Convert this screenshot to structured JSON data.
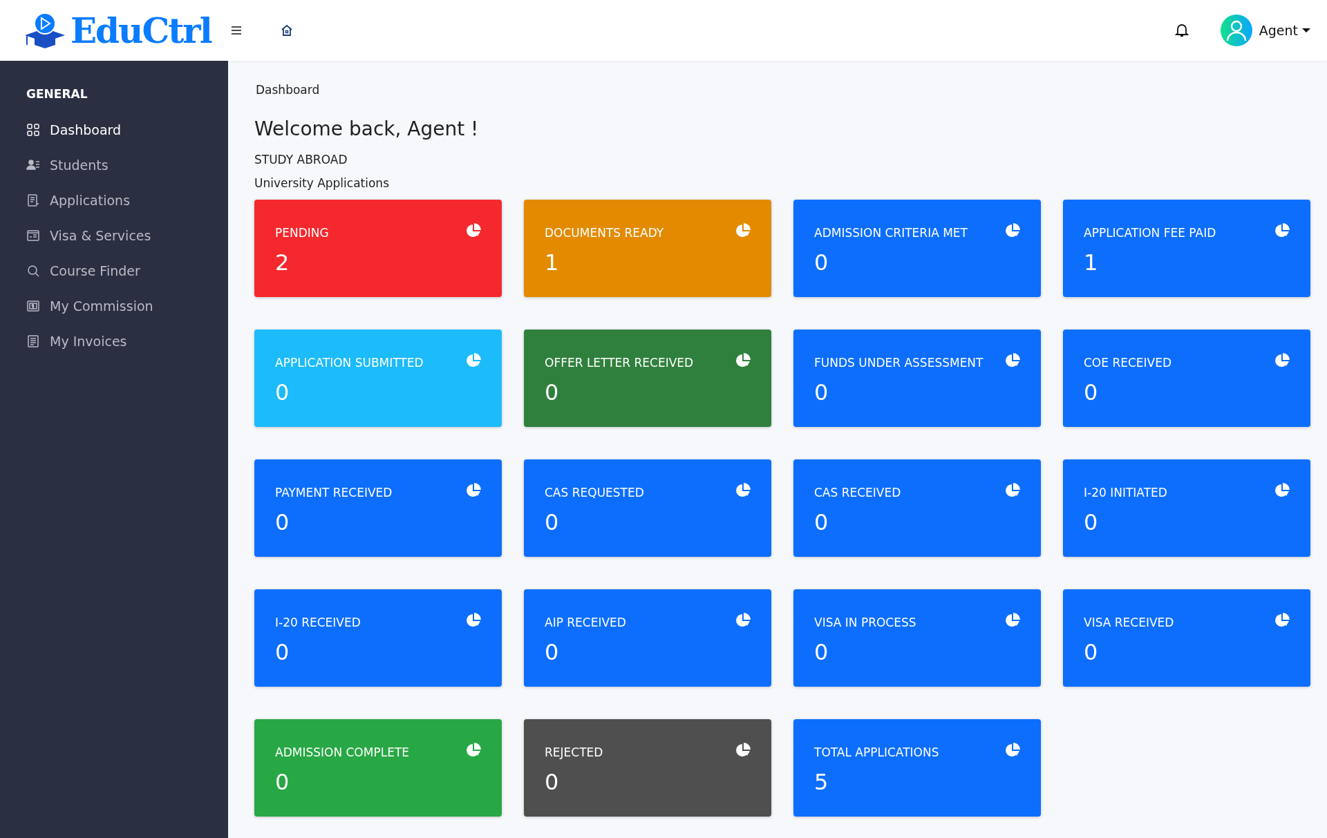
{
  "header": {
    "logo": "EduCtrl",
    "user": "Agent"
  },
  "sidebar": {
    "section": "GENERAL",
    "items": [
      {
        "label": "Dashboard",
        "selected": true
      },
      {
        "label": "Students",
        "selected": false
      },
      {
        "label": "Applications",
        "selected": false
      },
      {
        "label": "Visa & Services",
        "selected": false
      },
      {
        "label": "Course Finder",
        "selected": false
      },
      {
        "label": "My Commission",
        "selected": false
      },
      {
        "label": "My Invoices",
        "selected": false
      }
    ]
  },
  "breadcrumb": "Dashboard",
  "welcome": "Welcome back, Agent !",
  "section": "STUDY ABROAD",
  "subsection": "University Applications",
  "cards": [
    {
      "title": "PENDING",
      "count": "2",
      "color": "#f5282d"
    },
    {
      "title": "DOCUMENTS READY",
      "count": "1",
      "color": "#e38a00"
    },
    {
      "title": "ADMISSION CRITERIA MET",
      "count": "0",
      "color": "#0d6efd"
    },
    {
      "title": "APPLICATION FEE PAID",
      "count": "1",
      "color": "#0d6efd"
    },
    {
      "title": "APPLICATION SUBMITTED",
      "count": "0",
      "color": "#1cbbf9"
    },
    {
      "title": "OFFER LETTER RECEIVED",
      "count": "0",
      "color": "#30803d"
    },
    {
      "title": "FUNDS UNDER ASSESSMENT",
      "count": "0",
      "color": "#0d6efd"
    },
    {
      "title": "COE RECEIVED",
      "count": "0",
      "color": "#0d6efd"
    },
    {
      "title": "PAYMENT RECEIVED",
      "count": "0",
      "color": "#0d6efd"
    },
    {
      "title": "CAS REQUESTED",
      "count": "0",
      "color": "#0d6efd"
    },
    {
      "title": "CAS RECEIVED",
      "count": "0",
      "color": "#0d6efd"
    },
    {
      "title": "I-20 INITIATED",
      "count": "0",
      "color": "#0d6efd"
    },
    {
      "title": "I-20 RECEIVED",
      "count": "0",
      "color": "#0d6efd"
    },
    {
      "title": "AIP RECEIVED",
      "count": "0",
      "color": "#0d6efd"
    },
    {
      "title": "VISA IN PROCESS",
      "count": "0",
      "color": "#0d6efd"
    },
    {
      "title": "VISA RECEIVED",
      "count": "0",
      "color": "#0d6efd"
    },
    {
      "title": "ADMISSION COMPLETE",
      "count": "0",
      "color": "#28a745"
    },
    {
      "title": "REJECTED",
      "count": "0",
      "color": "#4f4f4f"
    },
    {
      "title": "TOTAL APPLICATIONS",
      "count": "5",
      "color": "#0d6efd"
    }
  ]
}
